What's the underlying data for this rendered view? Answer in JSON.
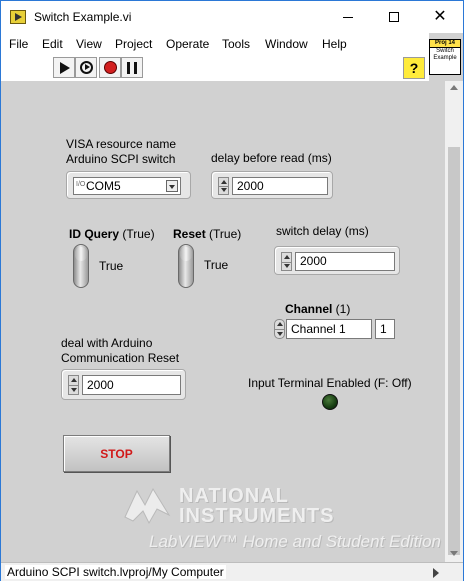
{
  "window": {
    "title": "Switch Example.vi",
    "minimize_icon": "minimize-icon",
    "maximize_icon": "maximize-icon",
    "close_icon": "close-icon"
  },
  "menu": [
    "File",
    "Edit",
    "View",
    "Project",
    "Operate",
    "Tools",
    "Window",
    "Help"
  ],
  "toolbar": {
    "buttons": [
      "run-icon",
      "run-continuously-icon",
      "abort-icon",
      "pause-icon"
    ],
    "help_label": "?"
  },
  "vi_icon": {
    "line1": "Proj 14",
    "line2": "Switch",
    "line3": "Example"
  },
  "controls": {
    "visa": {
      "label_line1": "VISA resource name",
      "label_line2": "Arduino SCPI switch",
      "prefix": "I/O",
      "value": "COM5"
    },
    "delay_before_read": {
      "label": "delay before read (ms)",
      "value": "2000"
    },
    "id_query": {
      "label_bold": "ID Query",
      "label_rest": " (True)",
      "state": "True"
    },
    "reset": {
      "label_bold": "Reset",
      "label_rest": " (True)",
      "state": "True"
    },
    "switch_delay": {
      "label": "switch delay (ms)",
      "value": "2000"
    },
    "channel": {
      "label_bold": "Channel",
      "label_rest": " (1)",
      "value": "Channel 1",
      "index": "1"
    },
    "comm_reset_delay": {
      "label_line1": "deal with Arduino",
      "label_line2": "Communication Reset",
      "value": "2000"
    },
    "input_terminal": {
      "label": "Input Terminal Enabled (F: Off)",
      "led_color": "#173e12"
    },
    "stop": {
      "label": "STOP",
      "color": "#d11919"
    }
  },
  "watermark": {
    "line1": "NATIONAL",
    "line2": "INSTRUMENTS",
    "line3": "LabVIEW™ Home and Student Edition"
  },
  "status": {
    "project_path": "Arduino SCPI switch.lvproj/My Computer"
  }
}
